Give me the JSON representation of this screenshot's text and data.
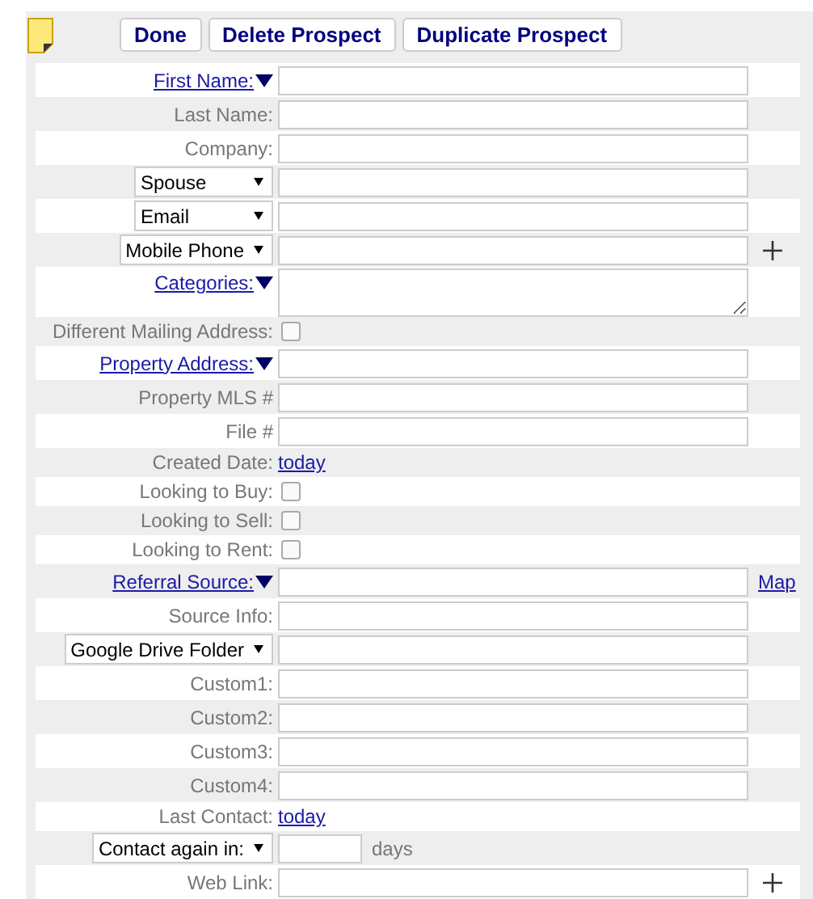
{
  "toolbar": {
    "buttons": [
      "Done",
      "Delete Prospect",
      "Duplicate Prospect"
    ]
  },
  "rows": [
    {
      "kind": "field",
      "label": {
        "kind": "link",
        "text": "First Name:"
      }
    },
    {
      "kind": "field",
      "label": {
        "kind": "text",
        "text": "Last Name:"
      }
    },
    {
      "kind": "field",
      "label": {
        "kind": "text",
        "text": "Company:"
      }
    },
    {
      "kind": "field",
      "label": {
        "kind": "select",
        "text": "Spouse"
      }
    },
    {
      "kind": "field",
      "label": {
        "kind": "select",
        "text": "Email"
      }
    },
    {
      "kind": "field",
      "label": {
        "kind": "select",
        "text": "Mobile Phone"
      },
      "extra": {
        "kind": "plus"
      }
    },
    {
      "kind": "textarea",
      "label": {
        "kind": "link",
        "text": "Categories:"
      }
    },
    {
      "kind": "checkbox",
      "label": {
        "kind": "text",
        "text": "Different Mailing Address:"
      },
      "checked": false
    },
    {
      "kind": "field",
      "label": {
        "kind": "link",
        "text": "Property Address:"
      }
    },
    {
      "kind": "field",
      "label": {
        "kind": "text",
        "text": "Property MLS #"
      }
    },
    {
      "kind": "field",
      "label": {
        "kind": "text",
        "text": "File #"
      }
    },
    {
      "kind": "date",
      "label": {
        "kind": "text",
        "text": "Created Date:"
      },
      "link": "today"
    },
    {
      "kind": "checkbox",
      "label": {
        "kind": "text",
        "text": "Looking to Buy:"
      },
      "checked": false
    },
    {
      "kind": "checkbox",
      "label": {
        "kind": "text",
        "text": "Looking to Sell:"
      },
      "checked": false
    },
    {
      "kind": "checkbox",
      "label": {
        "kind": "text",
        "text": "Looking to Rent:"
      },
      "checked": false
    },
    {
      "kind": "field",
      "label": {
        "kind": "link",
        "text": "Referral Source:"
      },
      "extra": {
        "kind": "link",
        "text": "Map"
      }
    },
    {
      "kind": "field",
      "label": {
        "kind": "text",
        "text": "Source Info:"
      }
    },
    {
      "kind": "field",
      "label": {
        "kind": "select",
        "text": "Google Drive Folder"
      }
    },
    {
      "kind": "field",
      "label": {
        "kind": "text",
        "text": "Custom1:"
      }
    },
    {
      "kind": "field",
      "label": {
        "kind": "text",
        "text": "Custom2:"
      }
    },
    {
      "kind": "field",
      "label": {
        "kind": "text",
        "text": "Custom3:"
      }
    },
    {
      "kind": "field",
      "label": {
        "kind": "text",
        "text": "Custom4:"
      }
    },
    {
      "kind": "date",
      "label": {
        "kind": "text",
        "text": "Last Contact:"
      },
      "link": "today"
    },
    {
      "kind": "days",
      "label": {
        "kind": "select",
        "text": "Contact again in:"
      },
      "suffix": "days"
    },
    {
      "kind": "field",
      "label": {
        "kind": "text",
        "text": "Web Link:"
      },
      "extra": {
        "kind": "plus"
      }
    }
  ]
}
